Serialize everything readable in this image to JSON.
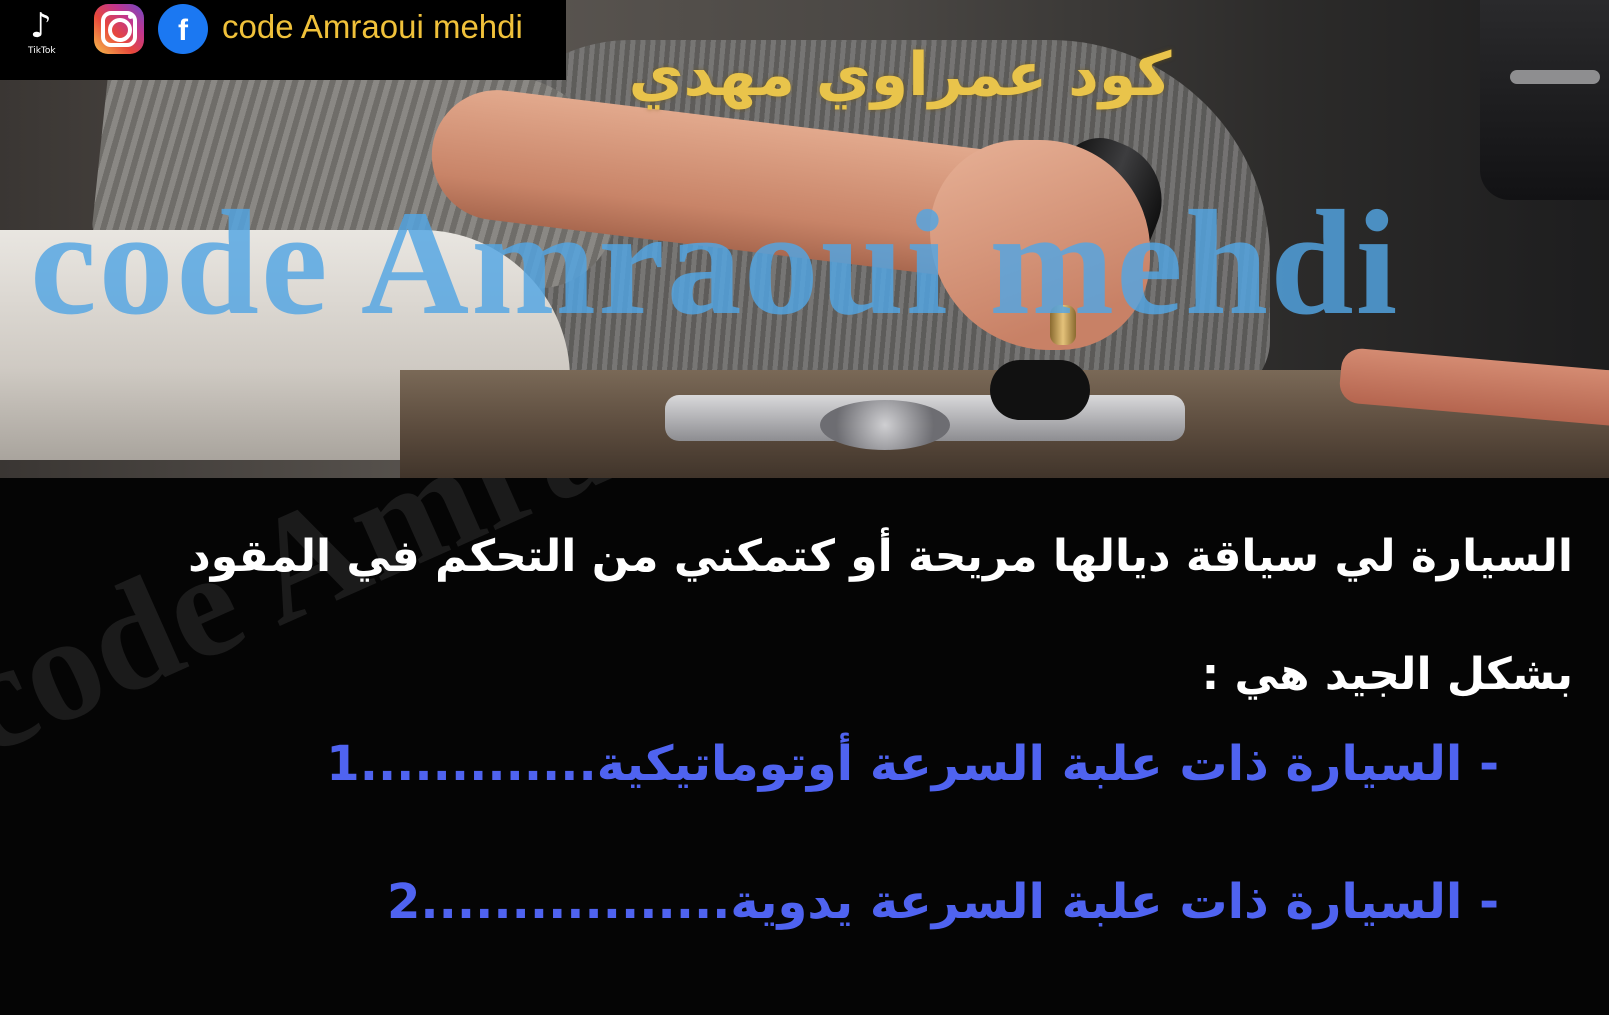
{
  "header": {
    "tiktok_label": "TikTok",
    "facebook_letter": "f",
    "handle": "code Amraoui mehdi",
    "colors": {
      "handle": "#f0c13a",
      "facebook": "#1b78f2"
    },
    "icons": [
      "tiktok-icon",
      "instagram-icon",
      "facebook-icon"
    ]
  },
  "photo": {
    "arabic_watermark": "كود عمراوي مهدي",
    "latin_watermark": "code Amraoui mehdi",
    "colors": {
      "arabic_watermark": "#e9c44b",
      "latin_watermark": "#53a6e4"
    }
  },
  "panel": {
    "background_watermark": "code Amraoui mehdi",
    "question": "السيارة لي سياقة ديالها مريحة أو كتمكني من التحكم في المقود بشكل الجيد هي :",
    "options": [
      {
        "text": "- السيارة ذات علبة السرعة أوتوماتيكية.............1"
      },
      {
        "text": "- السيارة ذات علبة السرعة يدوية.................2"
      }
    ],
    "colors": {
      "question": "#ffffff",
      "options": "#4f63f0"
    }
  }
}
